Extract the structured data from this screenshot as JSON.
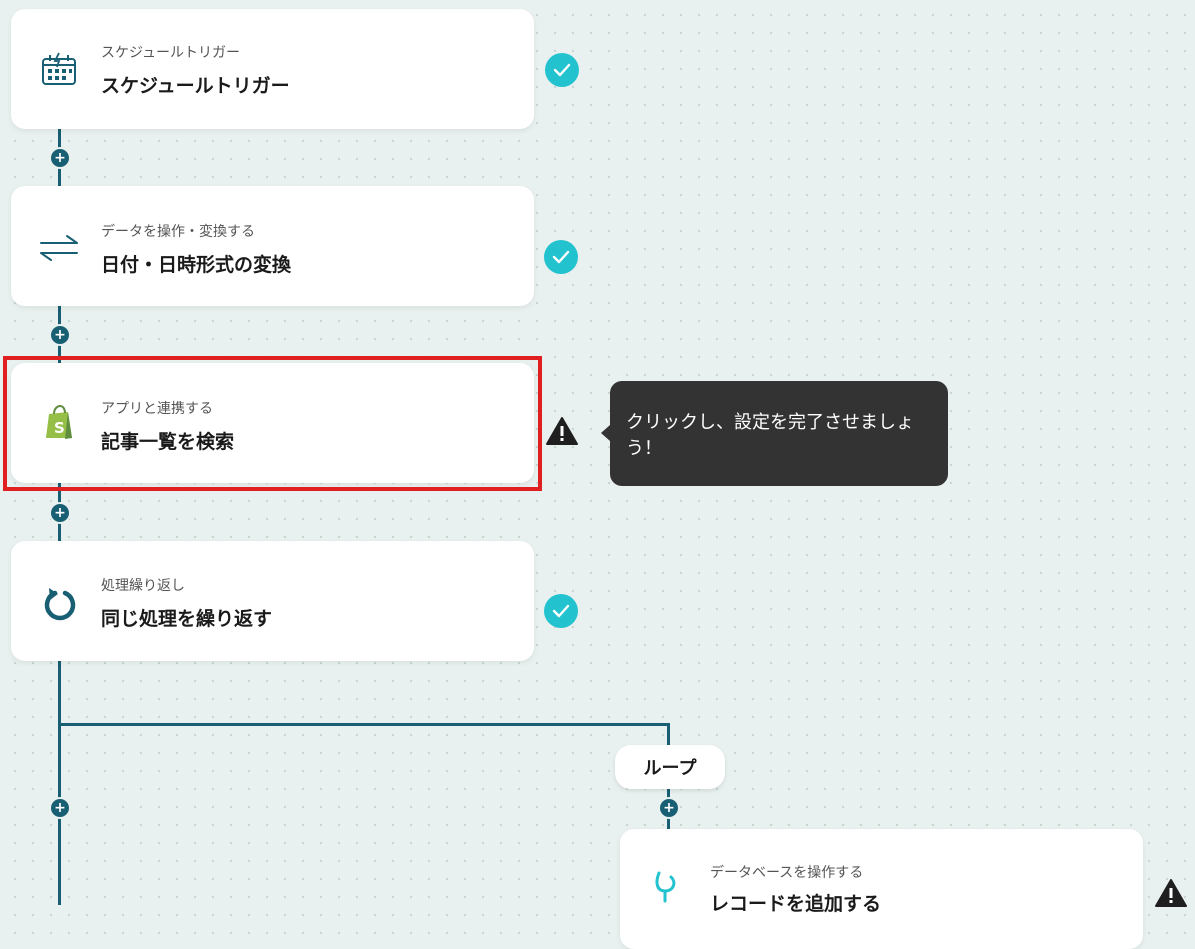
{
  "steps": [
    {
      "subtitle": "スケジュールトリガー",
      "title": "スケジュールトリガー",
      "icon": "schedule-calendar-icon",
      "status": "complete"
    },
    {
      "subtitle": "データを操作・変換する",
      "title": "日付・日時形式の変換",
      "icon": "convert-arrows-icon",
      "status": "complete"
    },
    {
      "subtitle": "アプリと連携する",
      "title": "記事一覧を検索",
      "icon": "shopify-icon",
      "status": "warning"
    },
    {
      "subtitle": "処理繰り返し",
      "title": "同じ処理を繰り返す",
      "icon": "loop-arrow-icon",
      "status": "complete"
    },
    {
      "subtitle": "データベースを操作する",
      "title": "レコードを追加する",
      "icon": "database-icon",
      "status": "warning"
    }
  ],
  "tooltip": {
    "text": "クリックし、設定を完了させましょう！"
  },
  "loop": {
    "label": "ループ"
  },
  "add_button": {
    "label": "+"
  },
  "colors": {
    "accent": "#185f73",
    "check": "#23c2cf",
    "highlight": "#e02020",
    "tooltip_bg": "#333333"
  }
}
